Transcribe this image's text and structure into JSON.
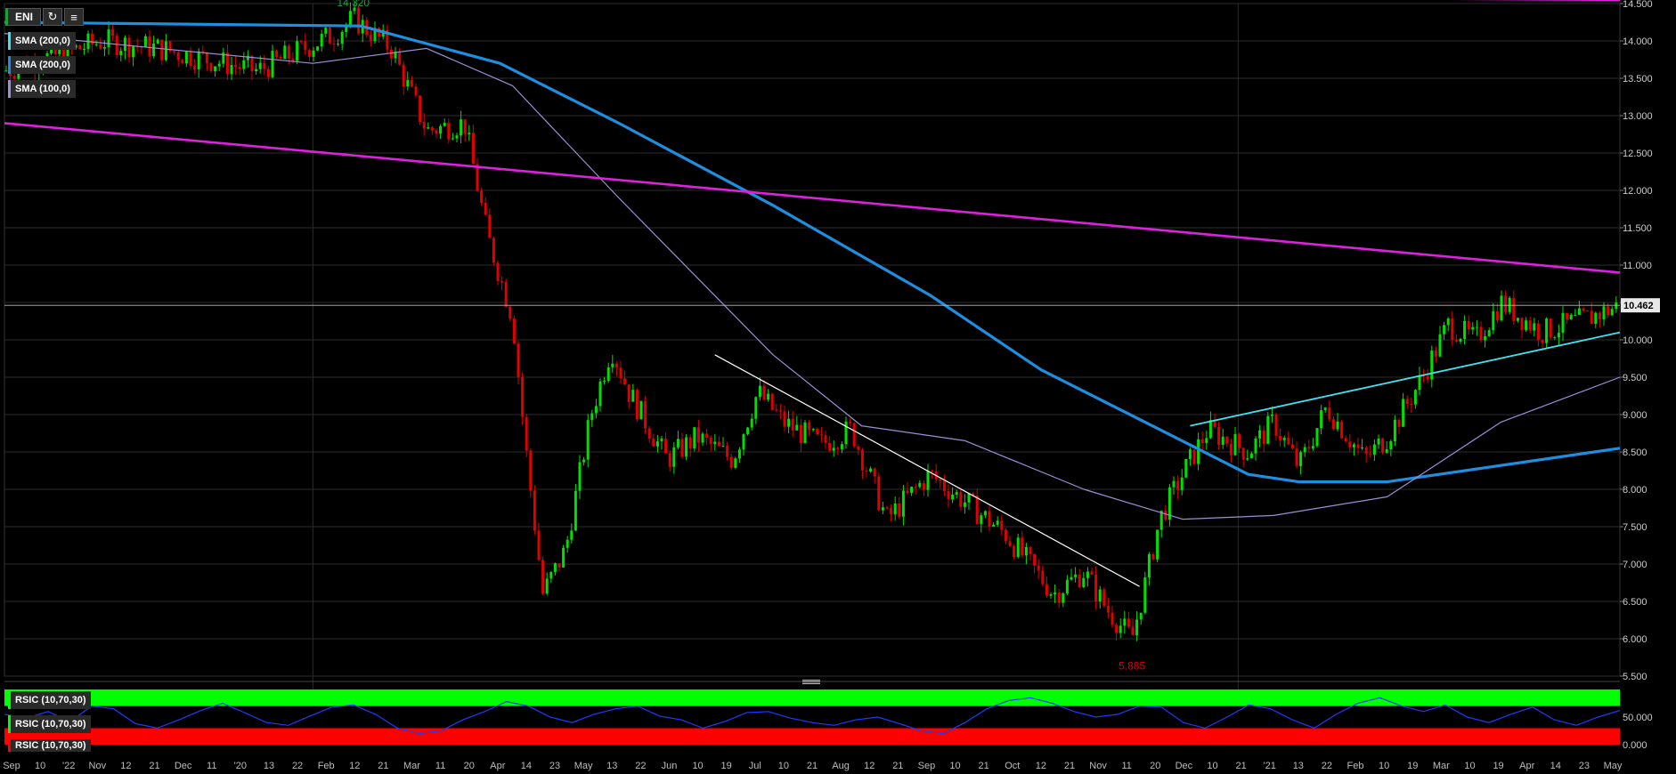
{
  "toolbar": {
    "symbol": "ENI",
    "refresh_icon": "refresh-icon",
    "chart_type_icon": "candles-icon"
  },
  "legends": {
    "sma200_cyan": "SMA (200,0)",
    "sma200_blue": "SMA (200,0)",
    "sma100": "SMA (100,0)",
    "rsic_1": "RSIC (10,70,30)",
    "rsic_2": "RSIC (10,70,30)",
    "rsic_3": "RSIC (10,70,30)"
  },
  "annotations": {
    "high": "14.320",
    "low": "5.885",
    "last_price": "10.462"
  },
  "colors": {
    "background": "#000000",
    "up_candle": "#00e000",
    "down_candle": "#e00000",
    "sma200": "#1e8fe0",
    "sma100": "#9b8fd8",
    "channel": "#e020e0",
    "trend_up": "#40e0f0",
    "trend_down": "#ffffff",
    "rsi_overbought": "#00ff00",
    "rsi_oversold": "#ff0000",
    "rsi_line": "#1a3cff"
  },
  "chart_data": [
    {
      "type": "candlestick",
      "title": "",
      "y_range": [
        5.5,
        14.5
      ],
      "y_ticks": [
        "14.500",
        "14.000",
        "13.500",
        "13.000",
        "12.500",
        "12.000",
        "11.500",
        "11.000",
        "10.500",
        "10.000",
        "9.500",
        "9.000",
        "8.500",
        "8.000",
        "7.500",
        "7.000",
        "6.500",
        "6.000",
        "5.500"
      ],
      "x_ticks": [
        "Sep",
        "10",
        "'22",
        "Nov",
        "12",
        "21",
        "Dec",
        "11",
        "'20",
        "13",
        "22",
        "Feb",
        "12",
        "21",
        "Mar",
        "11",
        "20",
        "Apr",
        "14",
        "23",
        "May",
        "13",
        "22",
        "Jun",
        "10",
        "19",
        "Jul",
        "10",
        "21",
        "Aug",
        "12",
        "21",
        "Sep",
        "10",
        "21",
        "Oct",
        "12",
        "21",
        "Nov",
        "11",
        "20",
        "Dec",
        "10",
        "21",
        "'21",
        "13",
        "22",
        "Feb",
        "10",
        "19",
        "Mar",
        "10",
        "19",
        "Apr",
        "14",
        "23",
        "May"
      ],
      "close_path": [
        {
          "d": "2019-09-01",
          "v": 13.6
        },
        {
          "d": "2019-10-10",
          "v": 14.0
        },
        {
          "d": "2019-11-01",
          "v": 13.9
        },
        {
          "d": "2019-12-10",
          "v": 13.6
        },
        {
          "d": "2020-01-10",
          "v": 14.1
        },
        {
          "d": "2020-01-17",
          "v": 14.3
        },
        {
          "d": "2020-02-01",
          "v": 13.9
        },
        {
          "d": "2020-02-15",
          "v": 12.8
        },
        {
          "d": "2020-03-01",
          "v": 12.9
        },
        {
          "d": "2020-03-10",
          "v": 11.4
        },
        {
          "d": "2020-03-20",
          "v": 10.3
        },
        {
          "d": "2020-03-25",
          "v": 8.6
        },
        {
          "d": "2020-04-01",
          "v": 6.6
        },
        {
          "d": "2020-04-10",
          "v": 7.2
        },
        {
          "d": "2020-04-20",
          "v": 9.0
        },
        {
          "d": "2020-04-28",
          "v": 9.9
        },
        {
          "d": "2020-05-05",
          "v": 9.3
        },
        {
          "d": "2020-05-20",
          "v": 8.4
        },
        {
          "d": "2020-06-01",
          "v": 8.7
        },
        {
          "d": "2020-06-15",
          "v": 8.4
        },
        {
          "d": "2020-06-25",
          "v": 9.3
        },
        {
          "d": "2020-07-05",
          "v": 8.9
        },
        {
          "d": "2020-07-20",
          "v": 8.6
        },
        {
          "d": "2020-08-01",
          "v": 8.8
        },
        {
          "d": "2020-08-15",
          "v": 7.6
        },
        {
          "d": "2020-09-01",
          "v": 8.2
        },
        {
          "d": "2020-09-20",
          "v": 7.7
        },
        {
          "d": "2020-10-01",
          "v": 7.4
        },
        {
          "d": "2020-10-20",
          "v": 6.6
        },
        {
          "d": "2020-11-01",
          "v": 6.9
        },
        {
          "d": "2020-11-10",
          "v": 6.4
        },
        {
          "d": "2020-11-20",
          "v": 6.0
        },
        {
          "d": "2020-11-25",
          "v": 6.7
        },
        {
          "d": "2020-12-01",
          "v": 7.6
        },
        {
          "d": "2020-12-10",
          "v": 8.2
        },
        {
          "d": "2020-12-20",
          "v": 8.8
        },
        {
          "d": "2021-01-05",
          "v": 8.5
        },
        {
          "d": "2021-01-15",
          "v": 8.9
        },
        {
          "d": "2021-01-25",
          "v": 8.3
        },
        {
          "d": "2021-02-05",
          "v": 9.1
        },
        {
          "d": "2021-02-20",
          "v": 8.4
        },
        {
          "d": "2021-03-01",
          "v": 8.7
        },
        {
          "d": "2021-03-15",
          "v": 9.5
        },
        {
          "d": "2021-03-25",
          "v": 10.2
        },
        {
          "d": "2021-04-05",
          "v": 10.0
        },
        {
          "d": "2021-04-15",
          "v": 10.5
        },
        {
          "d": "2021-05-01",
          "v": 10.1
        },
        {
          "d": "2021-05-20",
          "v": 10.3
        },
        {
          "d": "2021-06-01",
          "v": 10.46
        }
      ],
      "series": [
        {
          "name": "SMA (200,0)",
          "points": [
            {
              "d": "2019-09-01",
              "v": 14.25
            },
            {
              "d": "2020-01-20",
              "v": 14.2
            },
            {
              "d": "2020-03-15",
              "v": 13.7
            },
            {
              "d": "2020-05-01",
              "v": 12.9
            },
            {
              "d": "2020-07-01",
              "v": 11.8
            },
            {
              "d": "2020-09-01",
              "v": 10.6
            },
            {
              "d": "2020-10-15",
              "v": 9.6
            },
            {
              "d": "2020-12-01",
              "v": 8.8
            },
            {
              "d": "2021-01-05",
              "v": 8.2
            },
            {
              "d": "2021-01-25",
              "v": 8.1
            },
            {
              "d": "2021-03-01",
              "v": 8.1
            },
            {
              "d": "2021-06-01",
              "v": 8.55
            }
          ]
        },
        {
          "name": "SMA (100,0)",
          "points": [
            {
              "d": "2019-09-01",
              "v": 14.1
            },
            {
              "d": "2020-01-01",
              "v": 13.7
            },
            {
              "d": "2020-02-15",
              "v": 13.9
            },
            {
              "d": "2020-03-20",
              "v": 13.4
            },
            {
              "d": "2020-05-01",
              "v": 11.9
            },
            {
              "d": "2020-07-01",
              "v": 9.8
            },
            {
              "d": "2020-08-05",
              "v": 8.85
            },
            {
              "d": "2020-09-15",
              "v": 8.65
            },
            {
              "d": "2020-11-01",
              "v": 8.0
            },
            {
              "d": "2020-12-10",
              "v": 7.6
            },
            {
              "d": "2021-01-15",
              "v": 7.65
            },
            {
              "d": "2021-03-01",
              "v": 7.9
            },
            {
              "d": "2021-04-15",
              "v": 8.9
            },
            {
              "d": "2021-06-01",
              "v": 9.5
            }
          ]
        }
      ],
      "trend_lines": [
        {
          "from": {
            "d": "2019-09-01",
            "v": 12.9
          },
          "to": {
            "d": "2021-06-01",
            "v": 10.9
          }
        },
        {
          "from": {
            "d": "2020-09-25",
            "v": 14.6
          },
          "to": {
            "d": "2021-06-01",
            "v": 14.55
          }
        },
        {
          "from": {
            "d": "2020-12-13",
            "v": 8.85
          },
          "to": {
            "d": "2021-06-01",
            "v": 10.1
          }
        },
        {
          "from": {
            "d": "2020-06-08",
            "v": 9.8
          },
          "to": {
            "d": "2020-11-23",
            "v": 6.7
          }
        }
      ]
    },
    {
      "type": "line",
      "title": "",
      "y_range": [
        0,
        100
      ],
      "y_ticks": [
        "50.000",
        "0.000"
      ],
      "overbought": 70,
      "oversold": 30,
      "series": [
        {
          "name": "RSIC (10,70,30)",
          "values": [
            55,
            48,
            60,
            42,
            70,
            65,
            38,
            30,
            45,
            62,
            75,
            58,
            40,
            35,
            52,
            68,
            72,
            55,
            30,
            20,
            25,
            45,
            60,
            78,
            70,
            50,
            40,
            55,
            65,
            70,
            52,
            45,
            30,
            42,
            58,
            60,
            48,
            40,
            35,
            45,
            50,
            38,
            25,
            20,
            40,
            65,
            80,
            85,
            75,
            60,
            50,
            55,
            70,
            68,
            40,
            30,
            50,
            72,
            65,
            45,
            30,
            55,
            75,
            85,
            70,
            60,
            72,
            50,
            40,
            55,
            68,
            45,
            35,
            50,
            62
          ]
        }
      ]
    }
  ]
}
